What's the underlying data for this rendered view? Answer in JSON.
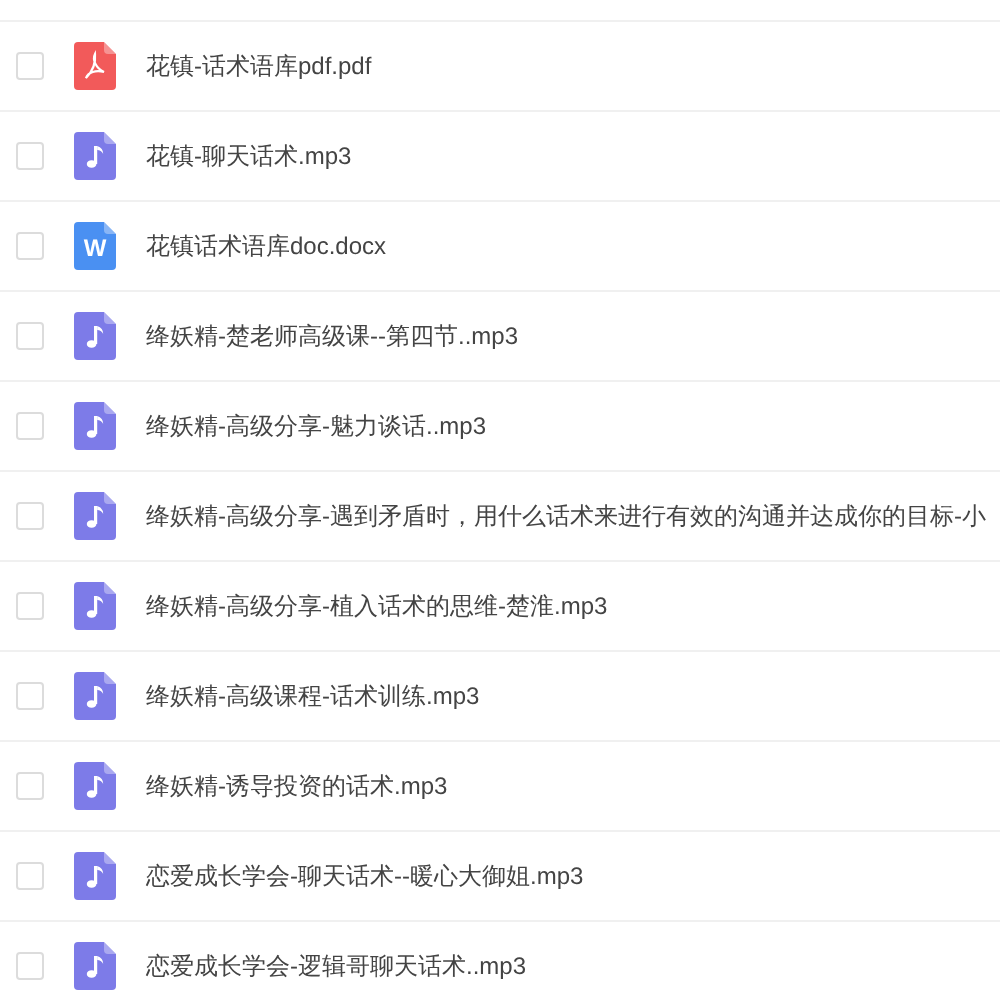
{
  "files": [
    {
      "name": "花镇-话术语库pdf.pdf",
      "kind": "pdf",
      "checked": false
    },
    {
      "name": "花镇-聊天话术.mp3",
      "kind": "audio",
      "checked": false
    },
    {
      "name": "花镇话术语库doc.docx",
      "kind": "word",
      "icon_letter": "W",
      "checked": false
    },
    {
      "name": "绛妖精-楚老师高级课--第四节..mp3",
      "kind": "audio",
      "checked": false
    },
    {
      "name": "绛妖精-高级分享-魅力谈话..mp3",
      "kind": "audio",
      "checked": false
    },
    {
      "name": "绛妖精-高级分享-遇到矛盾时，用什么话术来进行有效的沟通并达成你的目标-小",
      "kind": "audio",
      "checked": false
    },
    {
      "name": "绛妖精-高级分享-植入话术的思维-楚淮.mp3",
      "kind": "audio",
      "checked": false
    },
    {
      "name": "绛妖精-高级课程-话术训练.mp3",
      "kind": "audio",
      "checked": false
    },
    {
      "name": "绛妖精-诱导投资的话术.mp3",
      "kind": "audio",
      "checked": false
    },
    {
      "name": "恋爱成长学会-聊天话术--暖心大御姐.mp3",
      "kind": "audio",
      "checked": false
    },
    {
      "name": "恋爱成长学会-逻辑哥聊天话术..mp3",
      "kind": "audio",
      "checked": false
    }
  ]
}
